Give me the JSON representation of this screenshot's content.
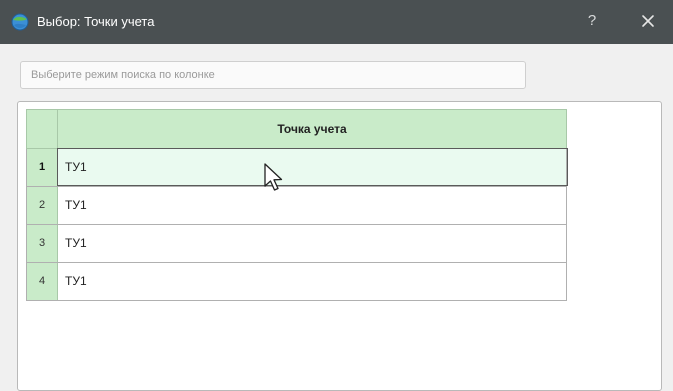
{
  "window": {
    "title": "Выбор: Точки учета",
    "help_label": "?",
    "app_icon": "app-globe-icon",
    "close_icon": "close-icon"
  },
  "search": {
    "placeholder": "Выберите режим поиска по колонке",
    "value": ""
  },
  "table": {
    "column_header": "Точка учета",
    "rows": [
      {
        "num": "1",
        "value": "ТУ1",
        "selected": true
      },
      {
        "num": "2",
        "value": "ТУ1",
        "selected": false
      },
      {
        "num": "3",
        "value": "ТУ1",
        "selected": false
      },
      {
        "num": "4",
        "value": "ТУ1",
        "selected": false
      }
    ]
  },
  "colors": {
    "titlebar": "#4a5052",
    "header_green": "#c9ebc9",
    "selected_row": "#eafaf0"
  }
}
